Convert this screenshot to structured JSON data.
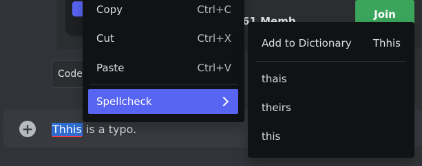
{
  "background": {
    "members_text": "61 Memb",
    "join_label": "Join",
    "code_label": "Code"
  },
  "composer": {
    "misspelled_word": "Thhis",
    "rest_text": " is a typo.",
    "add_symbol": "+"
  },
  "context_menu": {
    "items": [
      {
        "label": "Copy",
        "shortcut": "Ctrl+C"
      },
      {
        "label": "Cut",
        "shortcut": "Ctrl+X"
      },
      {
        "label": "Paste",
        "shortcut": "Ctrl+V"
      }
    ],
    "spellcheck_label": "Spellcheck"
  },
  "spellcheck_submenu": {
    "add_to_dictionary_label": "Add to Dictionary",
    "word": "Thhis",
    "suggestions": [
      "thais",
      "theirs",
      "this"
    ]
  },
  "colors": {
    "accent": "#5865f2",
    "join": "#3ba55c",
    "selection": "#2f6dd0",
    "typo_underline": "#f23f43"
  }
}
